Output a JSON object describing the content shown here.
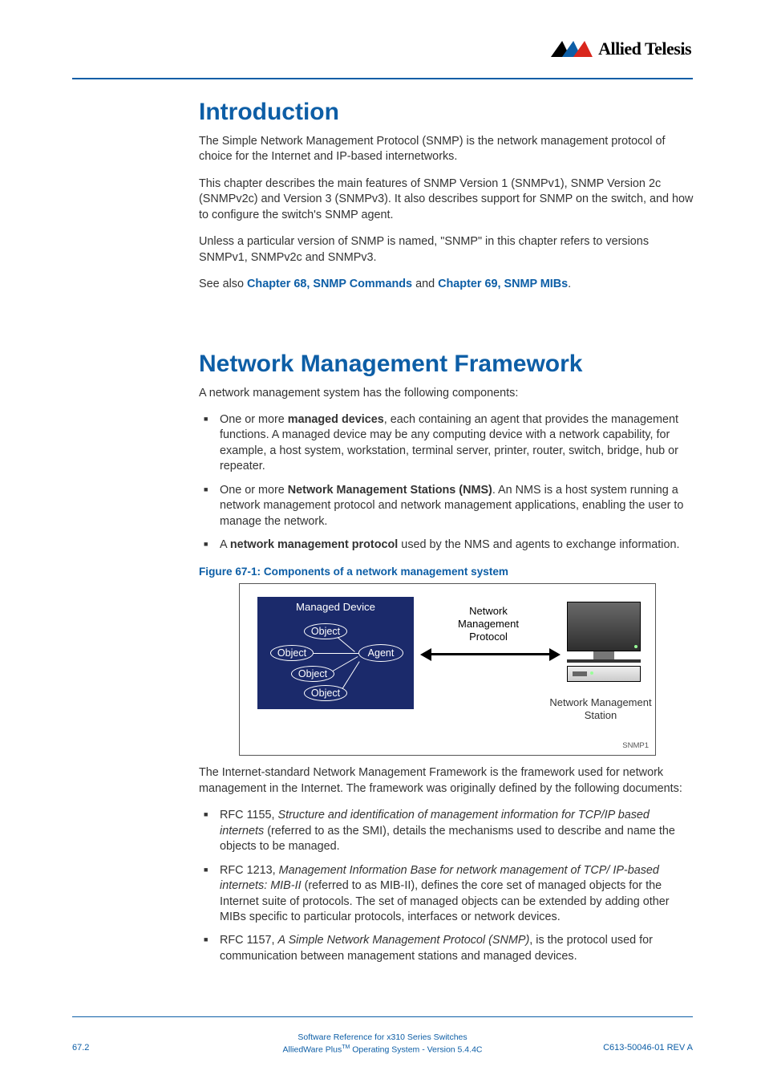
{
  "header": {
    "logo_text": "Allied Telesis"
  },
  "sections": {
    "intro": {
      "heading": "Introduction",
      "p1": "The Simple Network Management Protocol (SNMP) is the network management protocol of choice for the Internet and IP-based internetworks.",
      "p2": "This chapter describes the main features of SNMP Version 1 (SNMPv1), SNMP Version 2c (SNMPv2c) and Version 3 (SNMPv3). It also describes support for SNMP on the switch, and how to configure the switch's SNMP agent.",
      "p3": "Unless a particular version of SNMP is named, \"SNMP\" in this chapter refers to versions SNMPv1, SNMPv2c and SNMPv3.",
      "p4_prefix": "See also ",
      "p4_link1": "Chapter 68, SNMP Commands",
      "p4_mid": " and ",
      "p4_link2": "Chapter 69, SNMP MIBs",
      "p4_suffix": "."
    },
    "nmf": {
      "heading": "Network Management Framework",
      "p1": "A network management system has the following components:",
      "b1_pre": "One or more ",
      "b1_bold": "managed devices",
      "b1_post": ", each containing an agent that provides the management functions. A managed device may be any computing device with a network capability, for example, a host system, workstation, terminal server, printer, router, switch, bridge, hub or repeater.",
      "b2_pre": "One or more ",
      "b2_bold": "Network Management Stations (NMS)",
      "b2_post": ". An NMS is a host system running a network management protocol and network management applications, enabling the user to manage the network.",
      "b3_pre": "A ",
      "b3_bold": "network management protocol",
      "b3_post": " used by the NMS and agents to exchange information."
    }
  },
  "figure": {
    "caption": "Figure 67-1: Components of a network management system",
    "managed_device": "Managed Device",
    "object": "Object",
    "agent": "Agent",
    "nmp": "Network Management Protocol",
    "nms": "Network Management Station",
    "tag": "SNMP1"
  },
  "after_fig": {
    "p1": "The Internet-standard Network Management Framework is the framework used for network management in the Internet. The framework was originally defined by the following documents:",
    "r1_pre": "RFC 1155, ",
    "r1_it": "Structure and identification of management information for TCP/IP based internets",
    "r1_post": " (referred to as the SMI), details the mechanisms used to describe and name the objects to be managed.",
    "r2_pre": "RFC 1213, ",
    "r2_it": "Management Information Base for network management of TCP/ IP-based internets: MIB-II",
    "r2_post": " (referred to as MIB-II), defines the core set of managed objects for the Internet suite of protocols. The set of managed objects can be extended by adding other MIBs specific to particular protocols, interfaces or network devices.",
    "r3_pre": "RFC 1157, ",
    "r3_it": "A Simple Network Management Protocol (SNMP)",
    "r3_post": ", is the protocol used for communication between management stations and managed devices."
  },
  "footer": {
    "line1": "Software Reference for x310 Series Switches",
    "line2_pre": "AlliedWare Plus",
    "line2_tm": "TM",
    "line2_post": " Operating System  - Version 5.4.4C",
    "page_num": "67.2",
    "doc_rev": "C613-50046-01 REV A"
  }
}
